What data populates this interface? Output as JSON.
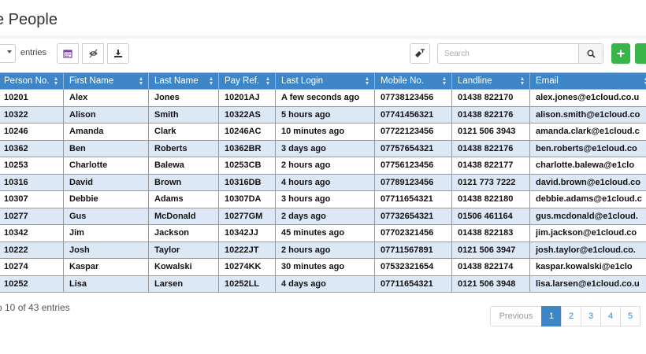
{
  "page": {
    "title": "e People"
  },
  "toolbar": {
    "entries_label": "entries",
    "search_placeholder": "Search",
    "icons": {
      "calendar": "calendar-icon",
      "view": "eye-off-icon",
      "download": "download-icon",
      "clear_filter": "clear-filter-icon",
      "search": "search-icon",
      "add": "plus-icon"
    },
    "colors": {
      "add_button": "#3ab54a",
      "header": "#3d87c9",
      "row_alt": "#dde8f6"
    }
  },
  "table": {
    "columns": [
      "Person No.",
      "First Name",
      "Last Name",
      "Pay Ref.",
      "Last Login",
      "Mobile No.",
      "Landline",
      "Email"
    ],
    "rows": [
      [
        "10201",
        "Alex",
        "Jones",
        "10201AJ",
        "A few seconds ago",
        "07738123456",
        "01438 822170",
        "alex.jones@e1cloud.co.u"
      ],
      [
        "10322",
        "Alison",
        "Smith",
        "10322AS",
        "5 hours ago",
        "07741456321",
        "01438 822176",
        "alison.smith@e1cloud.co"
      ],
      [
        "10246",
        "Amanda",
        "Clark",
        "10246AC",
        "10 minutes ago",
        "07722123456",
        "0121 506 3943",
        "amanda.clark@e1cloud.c"
      ],
      [
        "10362",
        "Ben",
        "Roberts",
        "10362BR",
        "3 days ago",
        "07757654321",
        "01438 822176",
        "ben.roberts@e1cloud.co"
      ],
      [
        "10253",
        "Charlotte",
        "Balewa",
        "10253CB",
        "2 hours ago",
        "07756123456",
        "01438 822177",
        "charlotte.balewa@e1clo"
      ],
      [
        "10316",
        "David",
        "Brown",
        "10316DB",
        "4 hours ago",
        "07789123456",
        "0121 773 7222",
        "david.brown@e1cloud.co"
      ],
      [
        "10307",
        "Debbie",
        "Adams",
        "10307DA",
        "3 hours ago",
        "07711654321",
        "01438 822180",
        "debbie.adams@e1cloud.c"
      ],
      [
        "10277",
        "Gus",
        "McDonald",
        "10277GM",
        "2 days ago",
        "07732654321",
        "01506 461164",
        "gus.mcdonald@e1cloud."
      ],
      [
        "10342",
        "Jim",
        "Jackson",
        "10342JJ",
        "45 minutes ago",
        "07702321456",
        "01438 822183",
        "jim.jackson@e1cloud.co"
      ],
      [
        "10222",
        "Josh",
        "Taylor",
        "10222JT",
        "2 hours ago",
        "07711567891",
        "0121 506 3947",
        "josh.taylor@e1cloud.co."
      ],
      [
        "10274",
        "Kaspar",
        "Kowalski",
        "10274KK",
        "30 minutes ago",
        "07532321654",
        "01438 822174",
        "kaspar.kowalski@e1clo"
      ],
      [
        "10252",
        "Lisa",
        "Larsen",
        "10252LL",
        "4 days ago",
        "07711654321",
        "0121 506 3948",
        "lisa.larsen@e1cloud.co.u"
      ]
    ]
  },
  "footer": {
    "info": "o 10 of 43 entries",
    "pagination": {
      "previous": "Previous",
      "pages": [
        "1",
        "2",
        "3",
        "4",
        "5"
      ],
      "active": "1"
    }
  }
}
